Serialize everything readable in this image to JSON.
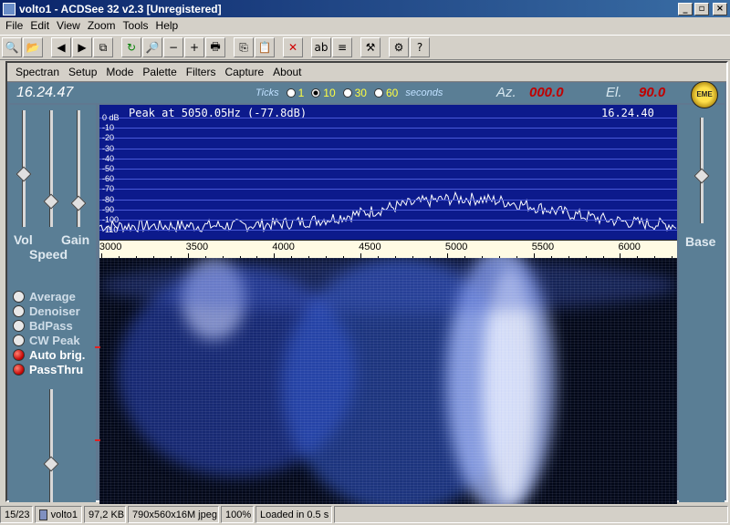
{
  "window": {
    "title": "volto1 - ACDSee 32 v2.3 [Unregistered]",
    "controls": {
      "minimize": "_",
      "maximize": "▫",
      "close": "×"
    }
  },
  "menubar": [
    "File",
    "Edit",
    "View",
    "Zoom",
    "Tools",
    "Help"
  ],
  "toolbar": {
    "icons": [
      "browse-icon",
      "open-folder-icon",
      "prev-icon",
      "next-icon",
      "slideshow-icon",
      "refresh-icon",
      "zoom-icon",
      "zoom-out-icon",
      "zoom-in-icon",
      "print-icon",
      "copy-icon",
      "paste-icon",
      "delete-icon",
      "rename-icon",
      "properties-icon",
      "tools-icon",
      "options-icon",
      "help-icon"
    ],
    "glyphs": [
      "🔍",
      "📂",
      "◀",
      "▶",
      "⧉",
      "↻",
      "🔎",
      "−",
      "+",
      "🖶",
      "⎘",
      "📋",
      "✕",
      "ab",
      "≡",
      "⚒",
      "⚙",
      "?"
    ]
  },
  "spectran": {
    "menu": [
      "Spectran",
      "Setup",
      "Mode",
      "Palette",
      "Filters",
      "Capture",
      "About"
    ],
    "clock": "16.24.47",
    "ticks": {
      "label": "Ticks",
      "options": [
        "1",
        "10",
        "30",
        "60"
      ],
      "selected": "10",
      "unit": "seconds"
    },
    "az_label": "Az.",
    "az_value": "000.0",
    "el_label": "El.",
    "el_value": "90.0",
    "logo_text": "EME",
    "left_labels": {
      "vol": "Vol",
      "gain": "Gain",
      "speed": "Speed"
    },
    "sliders": {
      "vol": 0.7,
      "gain": 0.7,
      "speed": 0.3,
      "base": 0.55
    },
    "options": [
      {
        "label": "Average",
        "on": false
      },
      {
        "label": "Denoiser",
        "on": false
      },
      {
        "label": "BdPass",
        "on": false
      },
      {
        "label": "CW Peak",
        "on": false
      },
      {
        "label": "Auto brig.",
        "on": true
      },
      {
        "label": "PassThru",
        "on": true
      }
    ],
    "right_label": "Base",
    "graph": {
      "peak_text": "Peak at  5050.05Hz (-77.8dB)",
      "time": "16.24.40",
      "db_labels": [
        "0 dB",
        "-10",
        "-20",
        "-30",
        "-40",
        "-50",
        "-60",
        "-70",
        "-80",
        "-90",
        "-100",
        "-110"
      ]
    },
    "freq_axis": [
      "3000",
      "3500",
      "4000",
      "4500",
      "5000",
      "5500",
      "6000"
    ]
  },
  "statusbar": {
    "position": "15/23",
    "filename": "volto1",
    "size": "97,2 KB",
    "dims": "790x560x16M jpeg",
    "zoom": "100%",
    "load": "Loaded in 0.5 s"
  }
}
